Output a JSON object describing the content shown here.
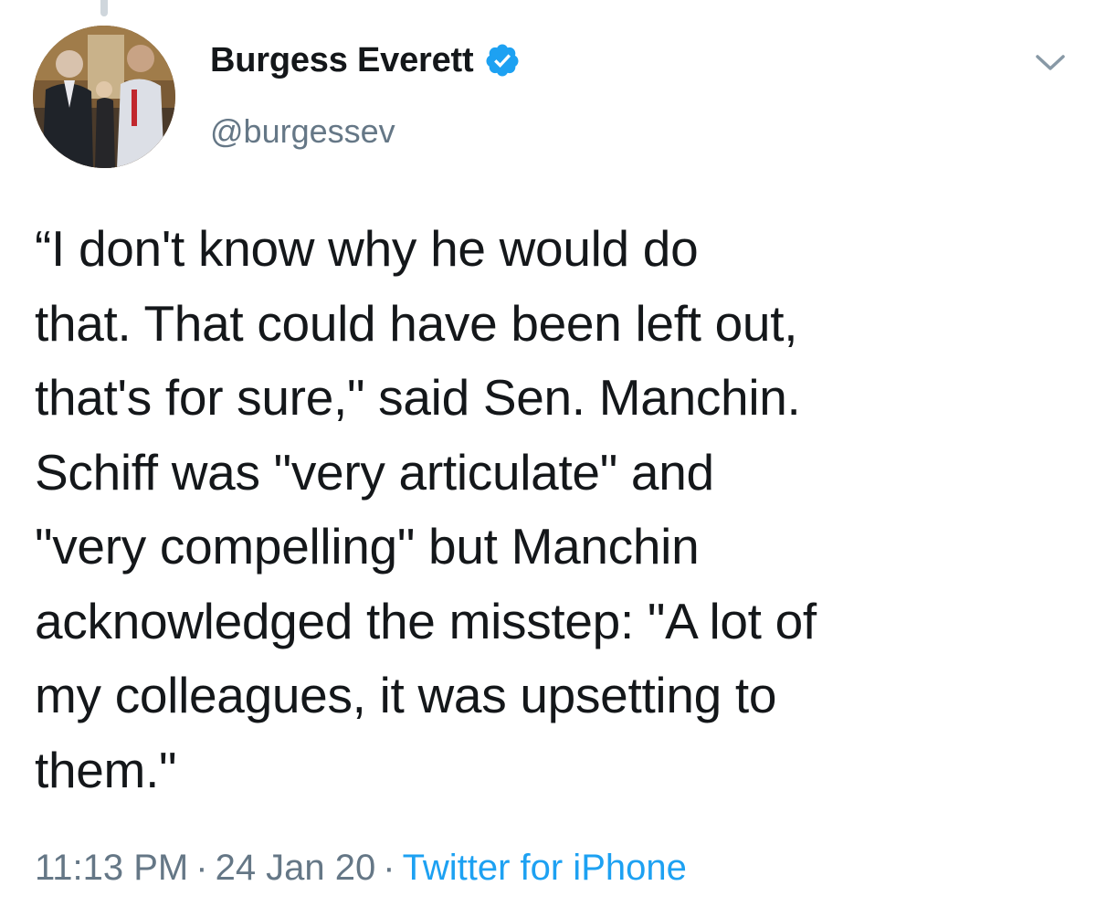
{
  "tweet": {
    "author": {
      "display_name": "Burgess Everett",
      "handle": "@burgessev",
      "verified": true,
      "verified_icon": "verified-badge-icon",
      "verified_color": "#1da1f2"
    },
    "menu_icon": "chevron-down-icon",
    "text": "“I don't know why he would do\nthat. That could have been left out,\nthat's for sure,\" said Sen. Manchin.\nSchiff was \"very articulate\" and\n\"very compelling\" but Manchin\nacknowledged the misstep: \"A lot of\nmy colleagues, it was upsetting to\nthem.\"",
    "time": "11:13 PM",
    "date": "24 Jan 20",
    "separator": "·",
    "source": "Twitter for iPhone"
  },
  "colors": {
    "text": "#14171a",
    "secondary": "#657786",
    "link": "#1da1f2"
  }
}
